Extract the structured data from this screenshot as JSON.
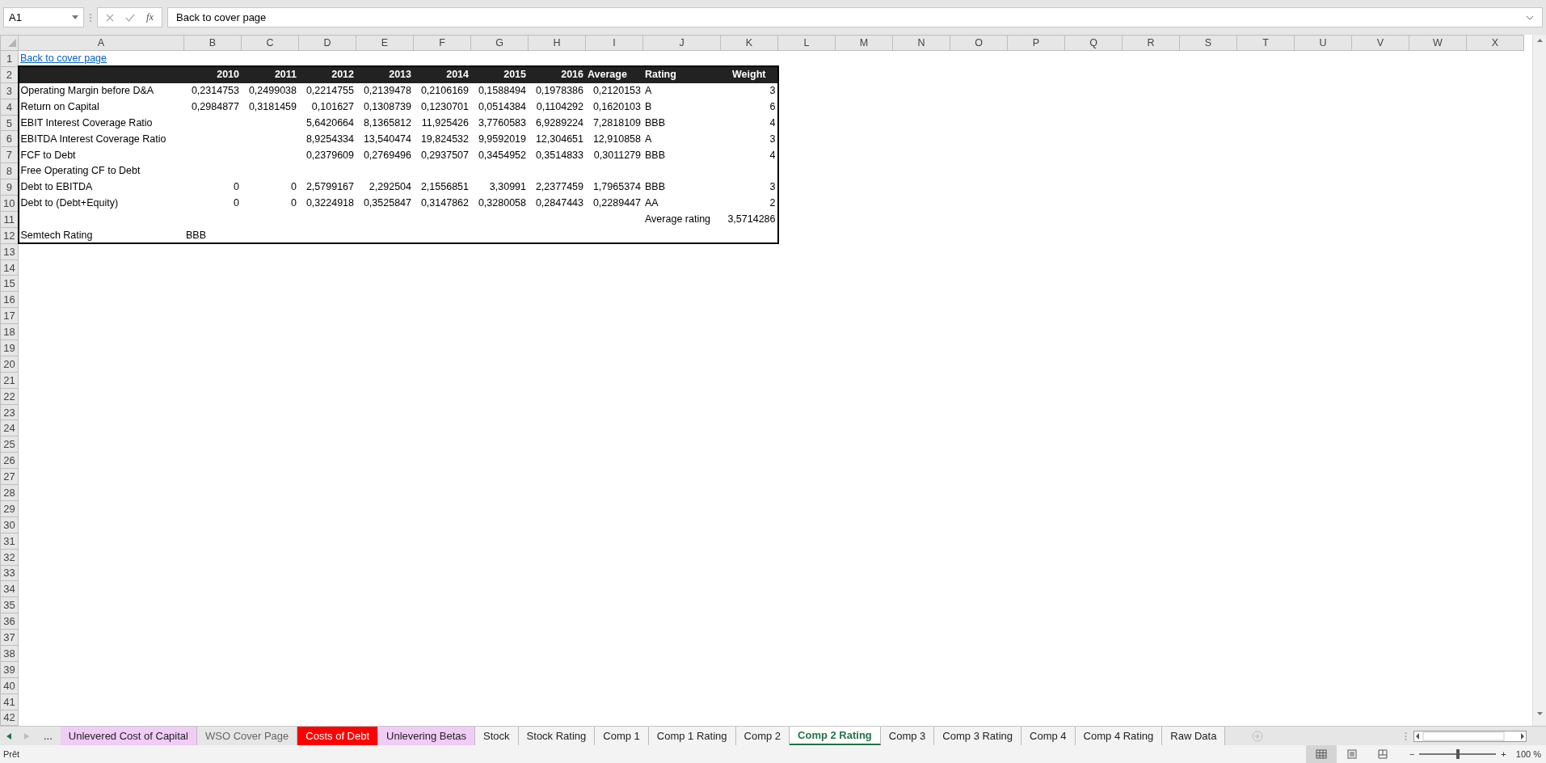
{
  "formula_bar": {
    "name_box": "A1",
    "function_label": "fx",
    "content": "Back to cover page"
  },
  "sheet": {
    "column_headers": [
      "A",
      "B",
      "C",
      "D",
      "E",
      "F",
      "G",
      "H",
      "I",
      "J",
      "K",
      "L",
      "M",
      "N",
      "O",
      "P",
      "Q",
      "R",
      "S",
      "T",
      "U",
      "V",
      "W",
      "X"
    ],
    "row_numbers": [
      "1",
      "2",
      "3",
      "4",
      "5",
      "6",
      "7",
      "8",
      "9",
      "10",
      "11",
      "12",
      "13",
      "14",
      "15",
      "16",
      "17",
      "18",
      "19",
      "20",
      "21",
      "22",
      "23",
      "24",
      "25",
      "26",
      "27",
      "28",
      "29",
      "30",
      "31",
      "32",
      "33",
      "34",
      "35",
      "36",
      "37",
      "38",
      "39",
      "40",
      "41",
      "42"
    ],
    "rows": [
      {
        "kind": "link",
        "cells": [
          {
            "text": "Back to cover page",
            "kind": "text"
          }
        ]
      },
      {
        "kind": "header",
        "cells": [
          null,
          {
            "text": "2010",
            "kind": "number"
          },
          {
            "text": "2011",
            "kind": "number"
          },
          {
            "text": "2012",
            "kind": "number"
          },
          {
            "text": "2013",
            "kind": "number"
          },
          {
            "text": "2014",
            "kind": "number"
          },
          {
            "text": "2015",
            "kind": "number"
          },
          {
            "text": "2016",
            "kind": "number"
          },
          {
            "text": "Average",
            "kind": "text"
          },
          {
            "text": "Rating",
            "kind": "text"
          },
          {
            "text": "Weight",
            "kind": "center"
          }
        ]
      },
      {
        "kind": "body",
        "cells": [
          {
            "text": "Operating Margin before D&A",
            "kind": "text"
          },
          {
            "text": "0,2314753",
            "kind": "number"
          },
          {
            "text": "0,2499038",
            "kind": "number"
          },
          {
            "text": "0,2214755",
            "kind": "number"
          },
          {
            "text": "0,2139478",
            "kind": "number"
          },
          {
            "text": "0,2106169",
            "kind": "number"
          },
          {
            "text": "0,1588494",
            "kind": "number"
          },
          {
            "text": "0,1978386",
            "kind": "number"
          },
          {
            "text": "0,2120153",
            "kind": "number"
          },
          {
            "text": "A",
            "kind": "text"
          },
          {
            "text": "3",
            "kind": "number"
          }
        ]
      },
      {
        "kind": "body",
        "cells": [
          {
            "text": "Return on Capital",
            "kind": "text"
          },
          {
            "text": "0,2984877",
            "kind": "number"
          },
          {
            "text": "0,3181459",
            "kind": "number"
          },
          {
            "text": "0,101627",
            "kind": "number"
          },
          {
            "text": "0,1308739",
            "kind": "number"
          },
          {
            "text": "0,1230701",
            "kind": "number"
          },
          {
            "text": "0,0514384",
            "kind": "number"
          },
          {
            "text": "0,1104292",
            "kind": "number"
          },
          {
            "text": "0,1620103",
            "kind": "number"
          },
          {
            "text": "B",
            "kind": "text"
          },
          {
            "text": "6",
            "kind": "number"
          }
        ]
      },
      {
        "kind": "body",
        "cells": [
          {
            "text": "EBIT Interest Coverage Ratio",
            "kind": "text"
          },
          null,
          null,
          {
            "text": "5,6420664",
            "kind": "number"
          },
          {
            "text": "8,1365812",
            "kind": "number"
          },
          {
            "text": "11,925426",
            "kind": "number"
          },
          {
            "text": "3,7760583",
            "kind": "number"
          },
          {
            "text": "6,9289224",
            "kind": "number"
          },
          {
            "text": "7,2818109",
            "kind": "number"
          },
          {
            "text": "BBB",
            "kind": "text"
          },
          {
            "text": "4",
            "kind": "number"
          }
        ]
      },
      {
        "kind": "body",
        "cells": [
          {
            "text": "EBITDA Interest Coverage Ratio",
            "kind": "text"
          },
          null,
          null,
          {
            "text": "8,9254334",
            "kind": "number"
          },
          {
            "text": "13,540474",
            "kind": "number"
          },
          {
            "text": "19,824532",
            "kind": "number"
          },
          {
            "text": "9,9592019",
            "kind": "number"
          },
          {
            "text": "12,304651",
            "kind": "number"
          },
          {
            "text": "12,910858",
            "kind": "number"
          },
          {
            "text": "A",
            "kind": "text"
          },
          {
            "text": "3",
            "kind": "number"
          }
        ]
      },
      {
        "kind": "body",
        "cells": [
          {
            "text": "FCF to Debt",
            "kind": "text"
          },
          null,
          null,
          {
            "text": "0,2379609",
            "kind": "number"
          },
          {
            "text": "0,2769496",
            "kind": "number"
          },
          {
            "text": "0,2937507",
            "kind": "number"
          },
          {
            "text": "0,3454952",
            "kind": "number"
          },
          {
            "text": "0,3514833",
            "kind": "number"
          },
          {
            "text": "0,3011279",
            "kind": "number"
          },
          {
            "text": "BBB",
            "kind": "text"
          },
          {
            "text": "4",
            "kind": "number"
          }
        ]
      },
      {
        "kind": "body",
        "cells": [
          {
            "text": "Free Operating CF to Debt",
            "kind": "text"
          }
        ]
      },
      {
        "kind": "body",
        "cells": [
          {
            "text": "Debt to EBITDA",
            "kind": "text"
          },
          {
            "text": "0",
            "kind": "number"
          },
          {
            "text": "0",
            "kind": "number"
          },
          {
            "text": "2,5799167",
            "kind": "number"
          },
          {
            "text": "2,292504",
            "kind": "number"
          },
          {
            "text": "2,1556851",
            "kind": "number"
          },
          {
            "text": "3,30991",
            "kind": "number"
          },
          {
            "text": "2,2377459",
            "kind": "number"
          },
          {
            "text": "1,7965374",
            "kind": "number"
          },
          {
            "text": "BBB",
            "kind": "text"
          },
          {
            "text": "3",
            "kind": "number"
          }
        ]
      },
      {
        "kind": "body",
        "cells": [
          {
            "text": "Debt to (Debt+Equity)",
            "kind": "text"
          },
          {
            "text": "0",
            "kind": "number"
          },
          {
            "text": "0",
            "kind": "number"
          },
          {
            "text": "0,3224918",
            "kind": "number"
          },
          {
            "text": "0,3525847",
            "kind": "number"
          },
          {
            "text": "0,3147862",
            "kind": "number"
          },
          {
            "text": "0,3280058",
            "kind": "number"
          },
          {
            "text": "0,2847443",
            "kind": "number"
          },
          {
            "text": "0,2289447",
            "kind": "number"
          },
          {
            "text": "AA",
            "kind": "text"
          },
          {
            "text": "2",
            "kind": "number"
          }
        ]
      },
      {
        "kind": "body",
        "cells": [
          null,
          null,
          null,
          null,
          null,
          null,
          null,
          null,
          null,
          {
            "text": "Average rating",
            "kind": "text"
          },
          {
            "text": "3,5714286",
            "kind": "number"
          }
        ]
      },
      {
        "kind": "body",
        "cells": [
          {
            "text": "Semtech Rating",
            "kind": "text"
          },
          {
            "text": "BBB",
            "kind": "text"
          }
        ]
      }
    ]
  },
  "sheet_tabs": {
    "overflow_label": "...",
    "tabs": [
      {
        "label": "Unlevered Cost of Capital",
        "selected": false,
        "color": "#f0ccf7"
      },
      {
        "label": "WSO Cover Page",
        "selected": false,
        "color": "#e6e6e6"
      },
      {
        "label": "Costs of Debt",
        "selected": false,
        "color": "#ff0000"
      },
      {
        "label": "Unlevering Betas",
        "selected": false,
        "color": "#f0ccf7"
      },
      {
        "label": "Stock",
        "selected": false
      },
      {
        "label": "Stock Rating",
        "selected": false
      },
      {
        "label": "Comp 1",
        "selected": false
      },
      {
        "label": "Comp 1 Rating",
        "selected": false
      },
      {
        "label": "Comp 2",
        "selected": false
      },
      {
        "label": "Comp 2 Rating",
        "selected": true
      },
      {
        "label": "Comp 3",
        "selected": false
      },
      {
        "label": "Comp 3 Rating",
        "selected": false
      },
      {
        "label": "Comp 4",
        "selected": false
      },
      {
        "label": "Comp 4 Rating",
        "selected": false
      },
      {
        "label": "Raw Data",
        "selected": false
      }
    ]
  },
  "status_bar": {
    "status": "Prêt",
    "views": [
      {
        "selected": true
      },
      {
        "selected": false
      },
      {
        "selected": false
      }
    ],
    "zoom": {
      "zoom_out": "−",
      "level": 0.5,
      "zoom_in": "+",
      "reading": "100 %"
    }
  }
}
